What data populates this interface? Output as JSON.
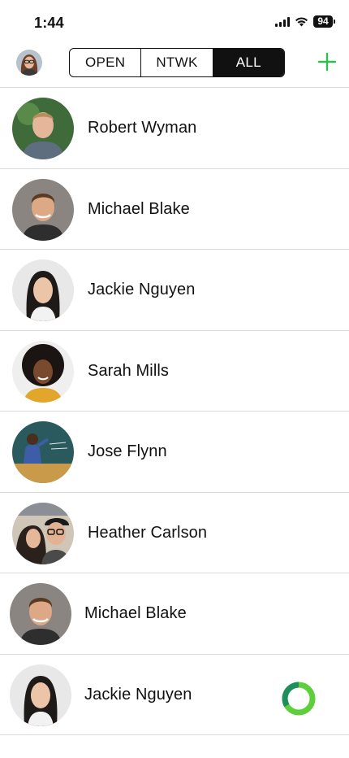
{
  "status_bar": {
    "time": "1:44",
    "battery": "94"
  },
  "header": {
    "tabs": [
      {
        "label": "OPEN",
        "active": false
      },
      {
        "label": "NTWK",
        "active": false
      },
      {
        "label": "ALL",
        "active": true
      }
    ],
    "add_icon": "plus-icon",
    "accent_color": "#2fbf4f"
  },
  "contacts": [
    {
      "name": "Robert Wyman"
    },
    {
      "name": "Michael Blake"
    },
    {
      "name": "Jackie Nguyen"
    },
    {
      "name": "Sarah Mills"
    },
    {
      "name": "Jose Flynn"
    },
    {
      "name": "Heather Carlson"
    },
    {
      "name": "Michael Blake"
    },
    {
      "name": "Jackie Nguyen"
    }
  ],
  "loading_indicator": {
    "icon": "loading-ring-icon",
    "colors": [
      "#1e8f5a",
      "#5ccf3a"
    ]
  }
}
